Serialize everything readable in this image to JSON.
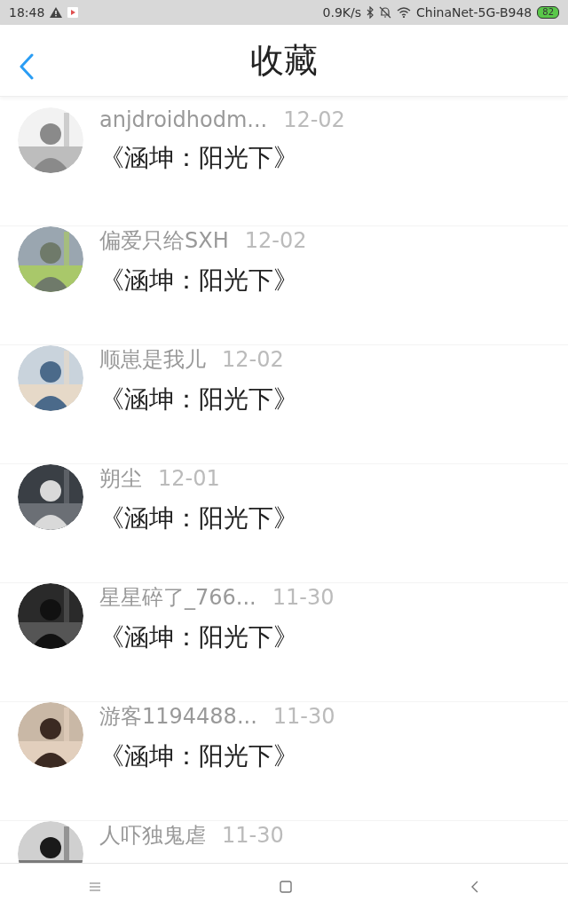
{
  "status_bar": {
    "time": "18:48",
    "speed": "0.9K/s",
    "network": "ChinaNet-5G-B948",
    "battery": "82"
  },
  "header": {
    "title": "收藏"
  },
  "items": [
    {
      "name": "anjdroidhodm...",
      "date": "12-02",
      "title": "《涵坤：阳光下》"
    },
    {
      "name": "偏爱只给SXH",
      "date": "12-02",
      "title": "《涵坤：阳光下》"
    },
    {
      "name": "顺崽是我儿",
      "date": "12-02",
      "title": "《涵坤：阳光下》"
    },
    {
      "name": "朔尘",
      "date": "12-01",
      "title": "《涵坤：阳光下》"
    },
    {
      "name": "星星碎了_766...",
      "date": "11-30",
      "title": "《涵坤：阳光下》"
    },
    {
      "name": "游客1194488...",
      "date": "11-30",
      "title": "《涵坤：阳光下》"
    },
    {
      "name": "人吓独鬼虐",
      "date": "11-30"
    }
  ]
}
